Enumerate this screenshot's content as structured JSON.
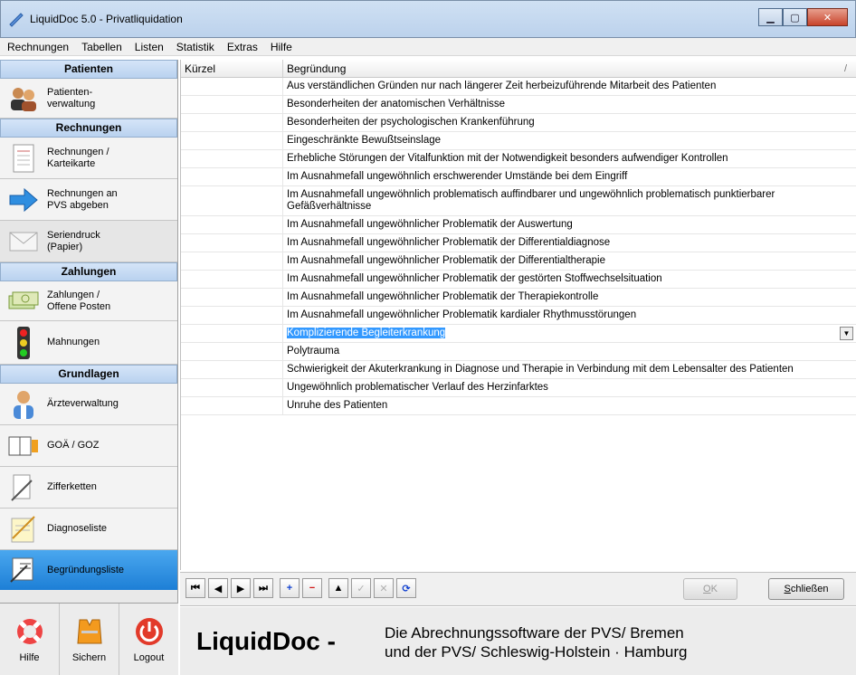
{
  "window": {
    "title": "LiquidDoc 5.0 - Privatliquidation",
    "controls": [
      "minimize-icon",
      "maximize-icon",
      "close-icon"
    ]
  },
  "menu": [
    "Rechnungen",
    "Tabellen",
    "Listen",
    "Statistik",
    "Extras",
    "Hilfe"
  ],
  "sidebar": {
    "sections": [
      {
        "title": "Patienten",
        "items": [
          {
            "label": "Patienten-\nverwaltung",
            "icon": "patients-icon"
          }
        ]
      },
      {
        "title": "Rechnungen",
        "items": [
          {
            "label": "Rechnungen /\nKarteikarte",
            "icon": "document-icon"
          },
          {
            "label": "Rechnungen an\nPVS abgeben",
            "icon": "arrow-right-icon"
          },
          {
            "label": "Seriendruck\n(Papier)",
            "icon": "envelope-icon"
          }
        ]
      },
      {
        "title": "Zahlungen",
        "items": [
          {
            "label": "Zahlungen /\nOffene Posten",
            "icon": "money-icon"
          },
          {
            "label": "Mahnungen",
            "icon": "traffic-light-icon"
          }
        ]
      },
      {
        "title": "Grundlagen",
        "items": [
          {
            "label": "Ärzteverwaltung",
            "icon": "doctor-icon"
          },
          {
            "label": "GOÄ / GOZ",
            "icon": "book-icon"
          },
          {
            "label": "Zifferketten",
            "icon": "pen-icon"
          },
          {
            "label": "Diagnoseliste",
            "icon": "notepad-icon"
          },
          {
            "label": "Begründungsliste",
            "icon": "list-pen-icon",
            "active": true
          }
        ]
      }
    ],
    "bottom": [
      {
        "label": "Hilfe",
        "icon": "lifebuoy-icon"
      },
      {
        "label": "Sichern",
        "icon": "life-vest-icon"
      },
      {
        "label": "Logout",
        "icon": "power-icon"
      }
    ]
  },
  "grid": {
    "columns": [
      "Kürzel",
      "Begründung"
    ],
    "sort_indicator": "/",
    "rows": [
      "Aus verständlichen Gründen nur nach längerer Zeit herbeizuführende Mitarbeit des Patienten",
      "Besonderheiten der anatomischen Verhältnisse",
      "Besonderheiten der psychologischen Krankenführung",
      "Eingeschränkte Bewußtseinslage",
      "Erhebliche Störungen der Vitalfunktion mit der Notwendigkeit besonders aufwendiger Kontrollen",
      "Im Ausnahmefall ungewöhnlich erschwerender Umstände bei dem Eingriff",
      "Im Ausnahmefall ungewöhnlich problematisch auffindbarer und ungewöhnlich problematisch punktierbarer Gefäßverhältnisse",
      "Im Ausnahmefall ungewöhnlicher Problematik der Auswertung",
      "Im Ausnahmefall ungewöhnlicher Problematik der Differentialdiagnose",
      "Im Ausnahmefall ungewöhnlicher Problematik der Differentialtherapie",
      "Im Ausnahmefall ungewöhnlicher Problematik der gestörten Stoffwechselsituation",
      "Im Ausnahmefall ungewöhnlicher Problematik der Therapiekontrolle",
      "Im Ausnahmefall ungewöhnlicher Problematik kardialer Rhythmusstörungen",
      "Komplizierende Begleiterkrankung",
      "Polytrauma",
      "Schwierigkeit der Akuterkrankung in Diagnose und Therapie in Verbindung mit dem Lebensalter des Patienten",
      "Ungewöhnlich problematischer Verlauf des Herzinfarktes",
      "Unruhe des Patienten"
    ],
    "selected_index": 13
  },
  "toolbar": {
    "nav": [
      {
        "glyph": "⏮",
        "name": "first-record-button"
      },
      {
        "glyph": "◀",
        "name": "prev-record-button"
      },
      {
        "glyph": "▶",
        "name": "next-record-button"
      },
      {
        "glyph": "⏭",
        "name": "last-record-button"
      },
      {
        "glyph": "+",
        "name": "add-record-button",
        "style": "blue"
      },
      {
        "glyph": "−",
        "name": "delete-record-button",
        "style": "red"
      },
      {
        "glyph": "▲",
        "name": "edit-record-button"
      },
      {
        "glyph": "✓",
        "name": "post-record-button",
        "style": "dis"
      },
      {
        "glyph": "✕",
        "name": "cancel-record-button",
        "style": "dis"
      },
      {
        "glyph": "⟳",
        "name": "refresh-button",
        "style": "blue"
      }
    ],
    "ok": {
      "pre": "",
      "u": "O",
      "post": "K"
    },
    "close": {
      "pre": "",
      "u": "S",
      "post": "chließen"
    }
  },
  "footer": {
    "brand": "LiquidDoc -",
    "tagline": "Die Abrechnungssoftware der PVS/ Bremen\nund der PVS/ Schleswig-Holstein · Hamburg"
  },
  "colors": {
    "accent_blue": "#1d7fd6",
    "selection": "#3399ff"
  }
}
